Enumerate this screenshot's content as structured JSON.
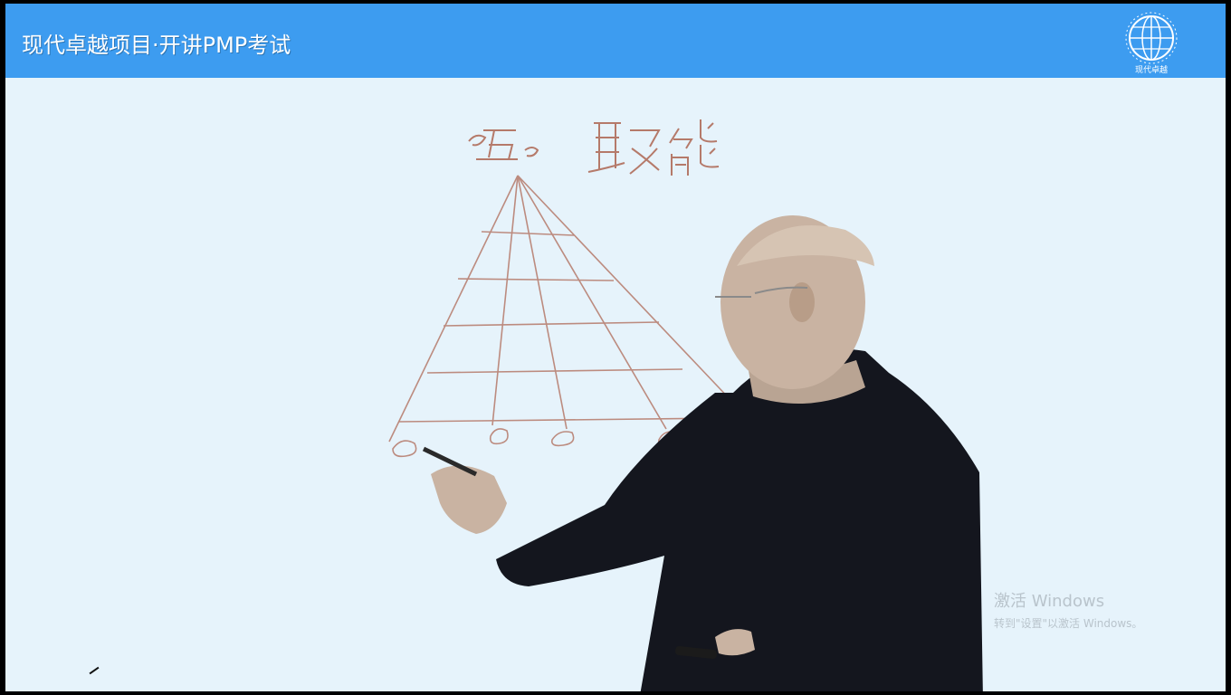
{
  "header": {
    "title": "现代卓越项目·开讲PMP考试",
    "logo_icon": "globe-logo-icon",
    "logo_caption": "现代卓越"
  },
  "board": {
    "heading": "五 职能",
    "diagram_icon": "pyramid-org-diagram",
    "nodes": [
      "o",
      "o",
      "o",
      "o"
    ]
  },
  "presenter": {
    "image_icon": "presenter-photo"
  },
  "watermark": {
    "line1": "激活 Windows",
    "line2": "转到\"设置\"以激活 Windows。"
  },
  "colors": {
    "banner": "#3d9cf0",
    "board_background": "#e6f3fb",
    "ink": "#b57a6a",
    "suit": "#14161e"
  }
}
